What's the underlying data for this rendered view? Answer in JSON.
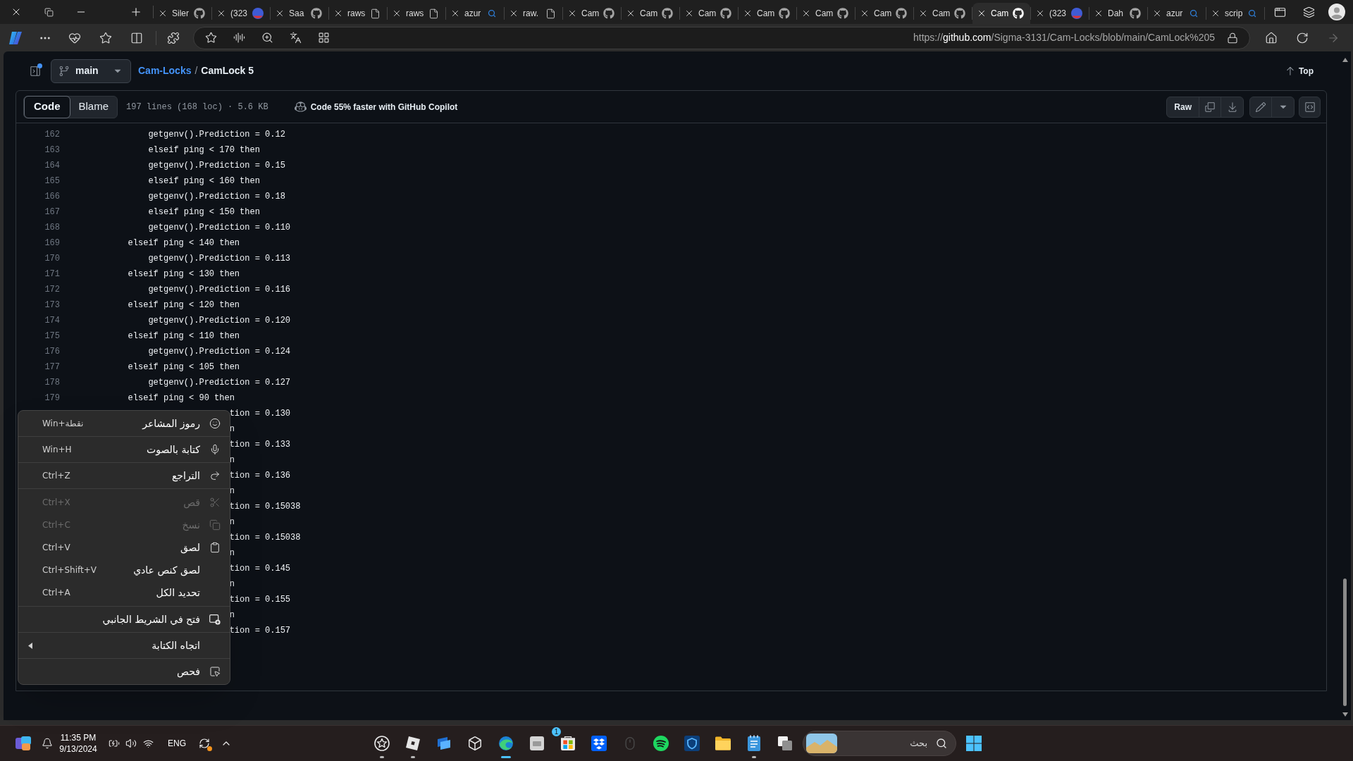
{
  "browser": {
    "tabs": [
      {
        "title": "Siler",
        "kind": "github",
        "selected": false
      },
      {
        "title": "(323",
        "kind": "avatar",
        "selected": false
      },
      {
        "title": "Saa",
        "kind": "github",
        "selected": false
      },
      {
        "title": "raws",
        "kind": "document",
        "selected": false
      },
      {
        "title": "raws",
        "kind": "document",
        "selected": false
      },
      {
        "title": "azur",
        "kind": "search",
        "selected": false
      },
      {
        "title": "raw.",
        "kind": "document",
        "selected": false
      },
      {
        "title": "Cam",
        "kind": "github",
        "selected": false
      },
      {
        "title": "Cam",
        "kind": "github",
        "selected": false
      },
      {
        "title": "Cam",
        "kind": "github",
        "selected": false
      },
      {
        "title": "Cam",
        "kind": "github",
        "selected": false
      },
      {
        "title": "Cam",
        "kind": "github",
        "selected": false
      },
      {
        "title": "Cam",
        "kind": "github",
        "selected": false
      },
      {
        "title": "Cam",
        "kind": "github",
        "selected": false
      },
      {
        "title": "Cam",
        "kind": "github",
        "selected": true
      },
      {
        "title": "(323",
        "kind": "avatar",
        "selected": false
      },
      {
        "title": "Dah",
        "kind": "github",
        "selected": false
      },
      {
        "title": "azur",
        "kind": "search",
        "selected": false
      },
      {
        "title": "scrip",
        "kind": "search",
        "selected": false
      }
    ],
    "address": {
      "scheme": "https://",
      "host": "github.com",
      "path": "/Sigma-3131/Cam-Locks/blob/main/CamLock%205"
    },
    "back_button": {
      "disabled": true
    }
  },
  "repo_header": {
    "sidebar_notification": true,
    "branch": "main",
    "repo": "Cam-Locks",
    "separator": "/",
    "file": "CamLock 5",
    "top_link": "Top"
  },
  "file_view": {
    "tabs": [
      {
        "label": "Code",
        "selected": true
      },
      {
        "label": "Blame",
        "selected": false
      }
    ],
    "stats": "197 lines (168 loc) · 5.6 KB",
    "copilot_promo": "Code 55% faster with GitHub Copilot",
    "raw_button": "Raw"
  },
  "code": {
    "lines": [
      {
        "kind": "full",
        "number": "162",
        "text": "            getgenv().Prediction = 0.12"
      },
      {
        "kind": "full",
        "number": "163",
        "text": "            elseif ping < 170 then"
      },
      {
        "kind": "full",
        "number": "164",
        "text": "            getgenv().Prediction = 0.15"
      },
      {
        "kind": "full",
        "number": "165",
        "text": "            elseif ping < 160 then"
      },
      {
        "kind": "full",
        "number": "166",
        "text": "            getgenv().Prediction = 0.18"
      },
      {
        "kind": "full",
        "number": "167",
        "text": "            elseif ping < 150 then"
      },
      {
        "kind": "full",
        "number": "168",
        "text": "            getgenv().Prediction = 0.110"
      },
      {
        "kind": "full",
        "number": "169",
        "text": "        elseif ping < 140 then"
      },
      {
        "kind": "full",
        "number": "170",
        "text": "            getgenv().Prediction = 0.113"
      },
      {
        "kind": "full",
        "number": "171",
        "text": "        elseif ping < 130 then"
      },
      {
        "kind": "full",
        "number": "172",
        "text": "            getgenv().Prediction = 0.116"
      },
      {
        "kind": "full",
        "number": "173",
        "text": "        elseif ping < 120 then"
      },
      {
        "kind": "full",
        "number": "174",
        "text": "            getgenv().Prediction = 0.120"
      },
      {
        "kind": "full",
        "number": "175",
        "text": "        elseif ping < 110 then"
      },
      {
        "kind": "full",
        "number": "176",
        "text": "            getgenv().Prediction = 0.124"
      },
      {
        "kind": "full",
        "number": "177",
        "text": "        elseif ping < 105 then"
      },
      {
        "kind": "full",
        "number": "178",
        "text": "            getgenv().Prediction = 0.127"
      },
      {
        "kind": "full",
        "number": "179",
        "text": "        elseif ping < 90 then"
      },
      {
        "kind": "partial",
        "text": "tion = 0.130"
      },
      {
        "kind": "partial",
        "text": "n"
      },
      {
        "kind": "partial",
        "text": "tion = 0.133"
      },
      {
        "kind": "partial",
        "text": "n"
      },
      {
        "kind": "partial",
        "text": "tion = 0.136"
      },
      {
        "kind": "partial",
        "text": "n"
      },
      {
        "kind": "partial",
        "text": "tion = 0.15038"
      },
      {
        "kind": "partial",
        "text": "n"
      },
      {
        "kind": "partial",
        "text": "tion = 0.15038"
      },
      {
        "kind": "partial",
        "text": "n"
      },
      {
        "kind": "partial",
        "text": "tion = 0.145"
      },
      {
        "kind": "partial",
        "text": "n"
      },
      {
        "kind": "partial",
        "text": "tion = 0.155"
      },
      {
        "kind": "partial",
        "text": "n"
      },
      {
        "kind": "partial",
        "text": "tion = 0.157"
      }
    ]
  },
  "context_menu": {
    "groups": [
      {
        "items": [
          {
            "label": "رموز المشاعر",
            "shortcut": "Win+نقطة",
            "disabled": false,
            "submenu": false
          }
        ]
      },
      {
        "items": [
          {
            "label": "كتابة بالصوت",
            "shortcut": "Win+H",
            "disabled": false,
            "submenu": false
          }
        ]
      },
      {
        "items": [
          {
            "label": "التراجع",
            "shortcut": "Ctrl+Z",
            "disabled": false,
            "submenu": false
          }
        ]
      },
      {
        "items": [
          {
            "label": "قص",
            "shortcut": "Ctrl+X",
            "disabled": true,
            "submenu": false
          },
          {
            "label": "نسخ",
            "shortcut": "Ctrl+C",
            "disabled": true,
            "submenu": false
          },
          {
            "label": "لصق",
            "shortcut": "Ctrl+V",
            "disabled": false,
            "submenu": false
          },
          {
            "label": "لصق كنص عادي",
            "shortcut": "Ctrl+Shift+V",
            "disabled": false,
            "submenu": false
          },
          {
            "label": "تحديد الكل",
            "shortcut": "Ctrl+A",
            "disabled": false,
            "submenu": false
          }
        ]
      },
      {
        "items": [
          {
            "label": "فتح في الشريط الجانبي",
            "disabled": false,
            "submenu": false
          }
        ]
      },
      {
        "items": [
          {
            "label": "اتجاه الكتابة",
            "disabled": false,
            "submenu": true
          }
        ]
      },
      {
        "items": [
          {
            "label": "فحص",
            "disabled": false,
            "submenu": false
          }
        ]
      }
    ]
  },
  "taskbar": {
    "clock": {
      "time": "11:35 PM",
      "date": "9/13/2024"
    },
    "language": "ENG",
    "apps": [
      {
        "running": true,
        "active": false
      },
      {
        "running": true,
        "active": false
      },
      {
        "running": false,
        "active": false
      },
      {
        "running": false,
        "active": false
      },
      {
        "running": true,
        "active": true
      },
      {
        "running": false,
        "active": false
      },
      {
        "running": false,
        "active": false,
        "badge": "1"
      },
      {
        "running": false,
        "active": false
      },
      {
        "running": false,
        "active": false
      },
      {
        "running": false,
        "active": false
      },
      {
        "running": false,
        "active": false
      },
      {
        "running": false,
        "active": false
      },
      {
        "running": true,
        "active": false
      },
      {
        "running": false,
        "active": false
      }
    ],
    "search": {
      "placeholder": "بحث"
    }
  }
}
